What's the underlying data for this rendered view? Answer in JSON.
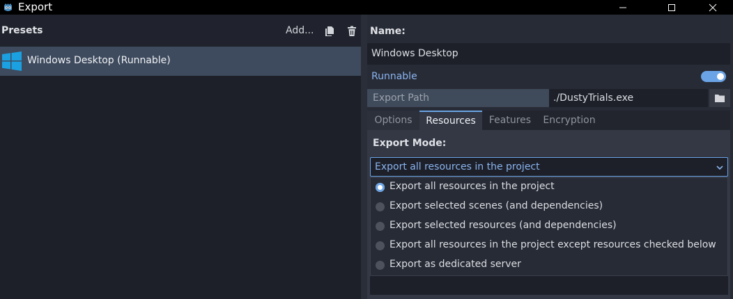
{
  "window": {
    "title": "Export",
    "min_icon": "minimize-icon",
    "max_icon": "maximize-icon",
    "close_icon": "close-icon"
  },
  "presets": {
    "title": "Presets",
    "add_label": "Add...",
    "items": [
      {
        "label": "Windows Desktop (Runnable)",
        "icon": "windows-logo-icon",
        "selected": true
      }
    ]
  },
  "preset": {
    "name_label": "Name:",
    "name_value": "Windows Desktop",
    "runnable_label": "Runnable",
    "runnable_on": true,
    "export_path_label": "Export Path",
    "export_path_value": "./DustyTrials.exe"
  },
  "tabs": [
    {
      "label": "Options"
    },
    {
      "label": "Resources",
      "active": true
    },
    {
      "label": "Features"
    },
    {
      "label": "Encryption"
    }
  ],
  "resources": {
    "export_mode_label": "Export Mode:",
    "selected": "Export all resources in the project",
    "options": [
      {
        "label": "Export all resources in the project",
        "checked": true
      },
      {
        "label": "Export selected scenes (and dependencies)",
        "checked": false
      },
      {
        "label": "Export selected resources (and dependencies)",
        "checked": false
      },
      {
        "label": "Export all resources in the project except resources checked below",
        "checked": false
      },
      {
        "label": "Export as dedicated server",
        "checked": false
      }
    ]
  },
  "colors": {
    "accent": "#6ba4e6",
    "selection": "#3e4b5e"
  }
}
